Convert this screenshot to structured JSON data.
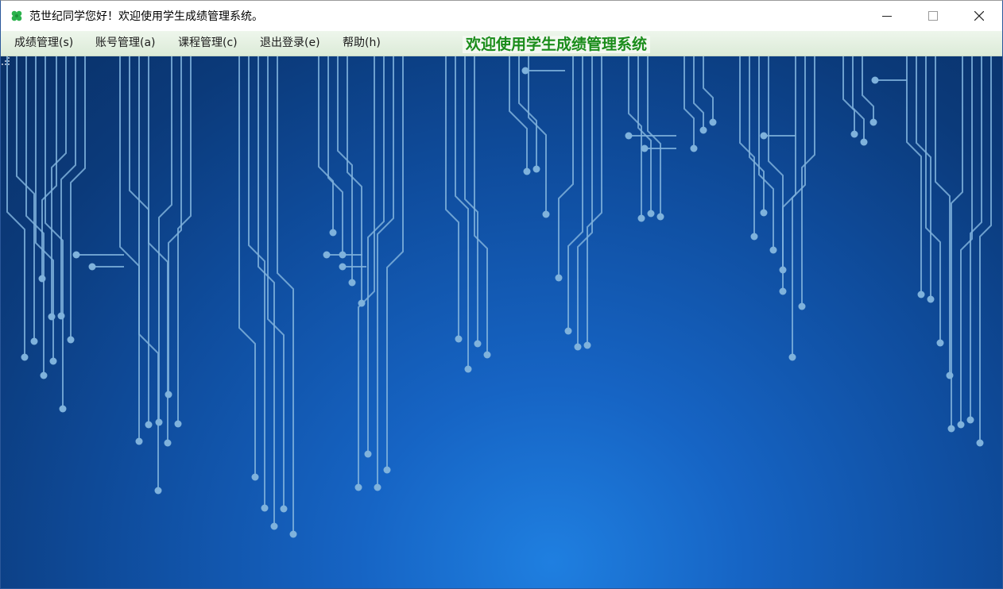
{
  "window": {
    "title": "范世纪同学您好！欢迎使用学生成绩管理系统。",
    "icon": "clover-icon",
    "controls": {
      "minimize_icon": "minimize-icon",
      "maximize_icon": "maximize-icon",
      "close_icon": "close-icon"
    }
  },
  "menubar": {
    "items": [
      {
        "label": "成绩管理(s)"
      },
      {
        "label": "账号管理(a)"
      },
      {
        "label": "课程管理(c)"
      },
      {
        "label": "退出登录(e)"
      },
      {
        "label": "帮助(h)"
      }
    ],
    "welcome": "欢迎使用学生成绩管理系统"
  },
  "main": {
    "background": "circuit-board-image"
  },
  "colors": {
    "welcome_text": "#1a8c1a",
    "menubar_bg": "#dcebd8",
    "background_dark": "#0a3168",
    "background_light": "#1f7fe0",
    "circuit_line": "#7fb2dc"
  }
}
